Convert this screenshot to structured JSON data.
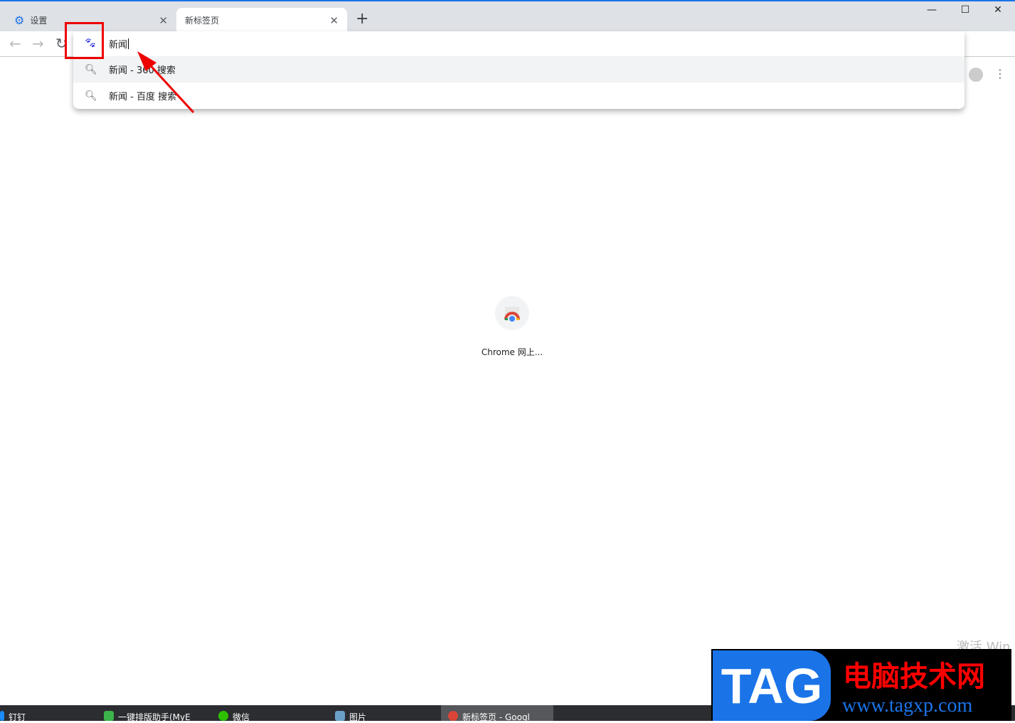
{
  "tabs": [
    {
      "label": "设置",
      "icon": "gear-icon"
    },
    {
      "label": "新标签页",
      "active": true
    }
  ],
  "omnibox": {
    "value": "新闻",
    "engine_icon": "baidu-paw-icon",
    "suggestions": [
      {
        "text": "新闻 - 360 搜索"
      },
      {
        "text": "新闻 - 百度 搜索"
      }
    ]
  },
  "shortcuts": [
    {
      "label": "Chrome 网上..."
    }
  ],
  "watermark": {
    "activate": "激活 Win"
  },
  "taskbar": [
    {
      "label": "钉钉"
    },
    {
      "label": "一键排版助手(MyE"
    },
    {
      "label": "微信"
    },
    {
      "label": "图片"
    },
    {
      "label": "新标签页 - Googl",
      "active": true
    }
  ],
  "logo": {
    "text": "TAG",
    "cn": "电脑技术网",
    "url": "www.tagxp.com"
  },
  "colors": {
    "accent": "#1a73e8",
    "annotation": "#ee0000"
  }
}
